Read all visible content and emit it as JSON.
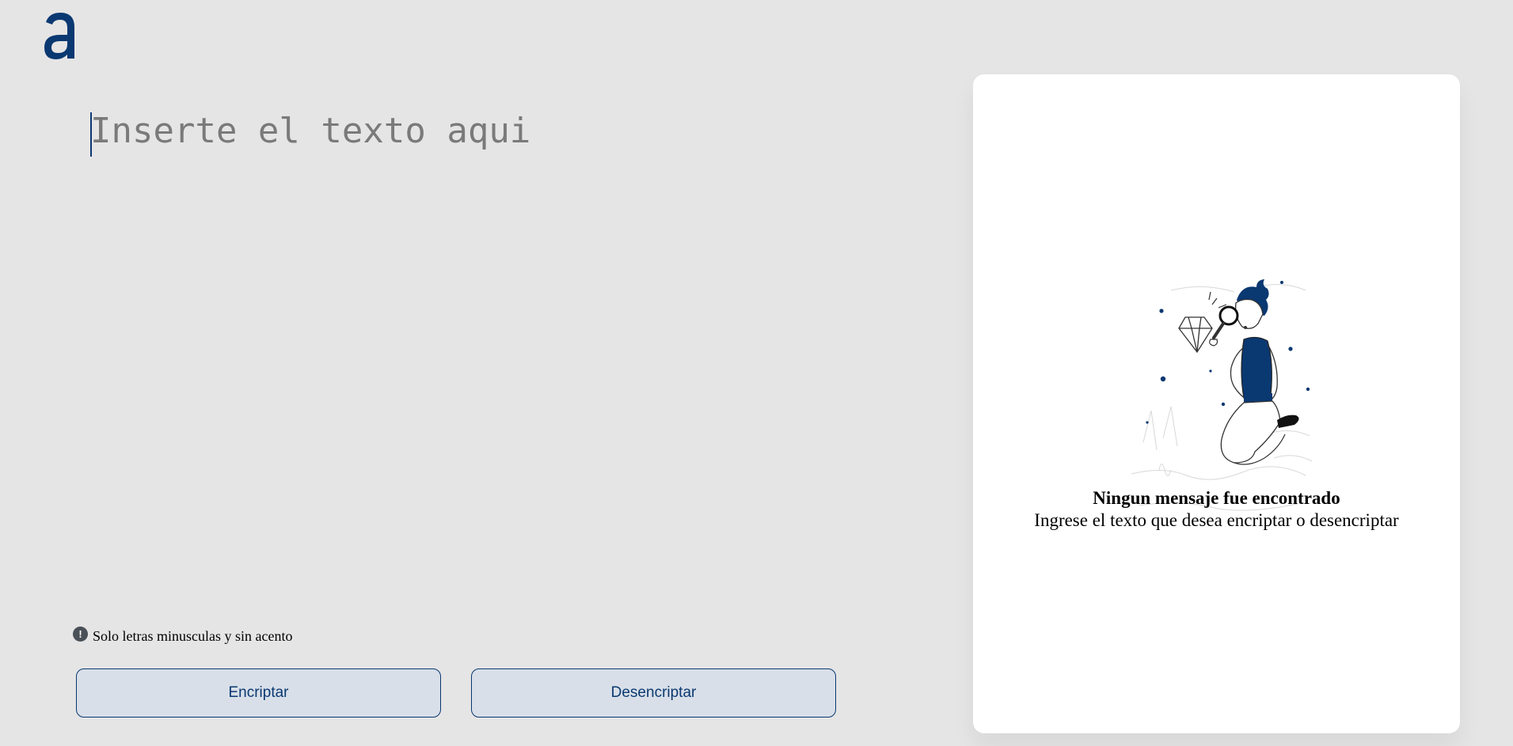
{
  "editor": {
    "placeholder": "Inserte el texto aqui",
    "value": ""
  },
  "hint": {
    "icon": "info-icon",
    "text": "Solo letras minusculas y sin acento"
  },
  "buttons": {
    "encrypt_label": "Encriptar",
    "decrypt_label": "Desencriptar"
  },
  "output_panel": {
    "title": "Ningun mensaje fue encontrado",
    "subtitle": "Ingrese el texto que desea encriptar o desencriptar",
    "illustration": "person-searching-diamond-illustration"
  },
  "colors": {
    "background": "#e5e5e5",
    "accent": "#0a3871",
    "button_bg": "#d8dfe8",
    "panel_bg": "#ffffff"
  }
}
